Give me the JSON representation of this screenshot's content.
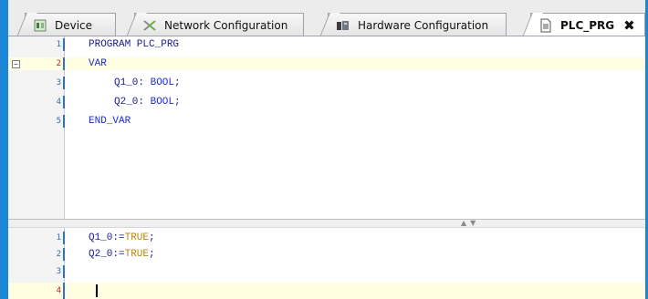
{
  "tabs": [
    {
      "label": "Device",
      "icon": "device-icon",
      "active": false
    },
    {
      "label": "Network Configuration",
      "icon": "network-config-icon",
      "active": false
    },
    {
      "label": "Hardware Configuration",
      "icon": "hardware-config-icon",
      "active": false
    },
    {
      "label": "PLC_PRG",
      "icon": "program-document-icon",
      "active": true,
      "close": "✖"
    }
  ],
  "declaration_editor": {
    "lines": [
      {
        "num": "1",
        "text": "PROGRAM PLC_PRG"
      },
      {
        "num": "2",
        "text": "VAR",
        "current": true,
        "fold": "−"
      },
      {
        "num": "3",
        "name": "Q1_0",
        "type": "BOOL"
      },
      {
        "num": "4",
        "name": "Q2_0",
        "type": "BOOL"
      },
      {
        "num": "5",
        "text": "END_VAR"
      }
    ]
  },
  "implementation_editor": {
    "lines": [
      {
        "num": "1",
        "target": "Q1_0",
        "op": ":=",
        "value": "TRUE",
        "end": ";"
      },
      {
        "num": "2",
        "target": "Q2_0",
        "op": ":=",
        "value": "TRUE",
        "end": ";"
      },
      {
        "num": "3"
      },
      {
        "num": "4",
        "current": true
      }
    ]
  },
  "colors": {
    "accent": "#1c87d6",
    "keyword": "#1c2cd1",
    "literal": "#b8860b",
    "current_line_bg": "#fffde2"
  }
}
